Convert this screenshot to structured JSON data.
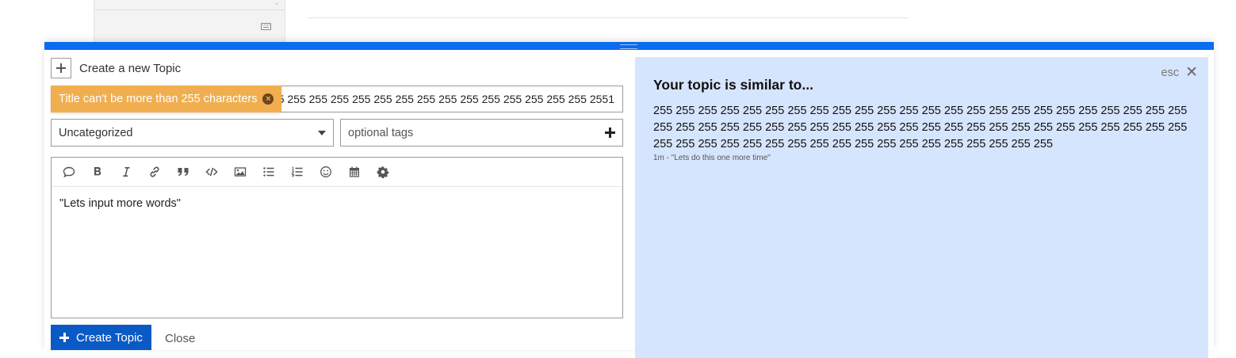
{
  "background": {
    "keyboard_icon": "keyboard-icon"
  },
  "composer": {
    "action": {
      "icon": "plus-icon",
      "title": "Create a new Topic"
    },
    "title_field": {
      "value": "55 255 255 255 255 255 255 255 255 255 255 255 255 255 255 2551"
    },
    "error_tooltip": {
      "message": "Title can't be more than 255 characters",
      "close_icon": "x-circle-icon"
    },
    "category": {
      "selected": "Uncategorized"
    },
    "tags": {
      "placeholder": "optional tags"
    },
    "toolbar": [
      {
        "name": "quote-icon",
        "title": "Quote"
      },
      {
        "name": "bold-icon",
        "title": "Bold"
      },
      {
        "name": "italic-icon",
        "title": "Italic"
      },
      {
        "name": "link-icon",
        "title": "Link"
      },
      {
        "name": "blockquote-icon",
        "title": "Blockquote"
      },
      {
        "name": "code-icon",
        "title": "Code"
      },
      {
        "name": "image-icon",
        "title": "Image"
      },
      {
        "name": "bullet-list-icon",
        "title": "Bulleted list"
      },
      {
        "name": "numbered-list-icon",
        "title": "Numbered list"
      },
      {
        "name": "emoji-icon",
        "title": "Emoji"
      },
      {
        "name": "calendar-icon",
        "title": "Date"
      },
      {
        "name": "gear-icon",
        "title": "Options"
      }
    ],
    "editor_text": "\"Lets input more words\"",
    "submit_label": "Create Topic",
    "cancel_label": "Close"
  },
  "similar": {
    "close_label": "esc",
    "heading": "Your topic is similar to...",
    "topic_title": "255 255 255 255 255 255 255 255 255 255 255 255 255 255 255 255 255 255 255 255 255 255 255 255 255 255 255 255 255 255 255 255 255 255 255 255 255 255 255 255 255 255 255 255 255 255 255 255 255 255 255 255 255 255 255 255 255 255 255 255 255 255 255 255 255 255",
    "topic_meta": "1m - \"Lets do this one more time\""
  }
}
